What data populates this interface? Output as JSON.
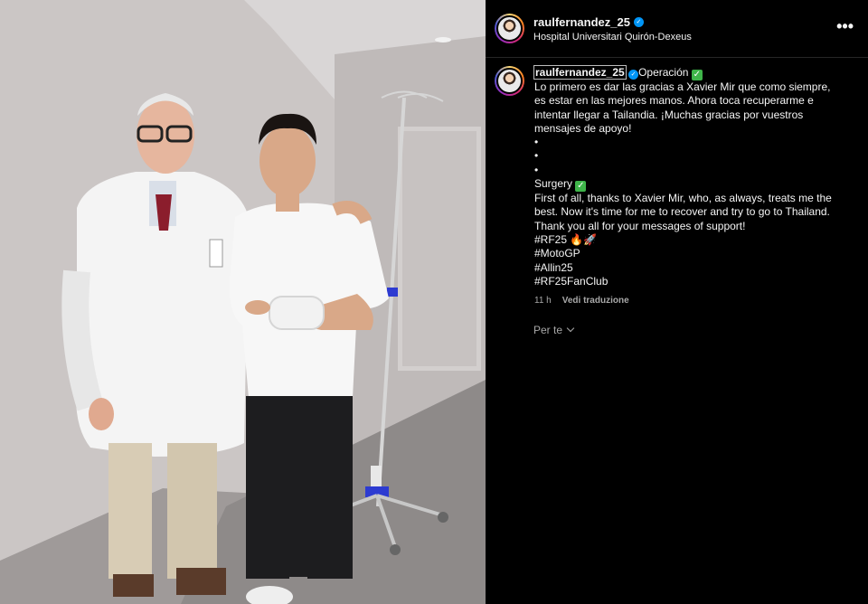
{
  "post": {
    "username": "raulfernandez_25",
    "location": "Hospital Universitari Quirón-Dexeus",
    "verified_icon": "verified-badge-icon",
    "more_icon": "more-options-icon",
    "more_glyph": "•••"
  },
  "caption": {
    "username": "raulfernandez_25",
    "title": "Operación",
    "spanish_lines": [
      "Lo primero es dar las gracias a Xavier Mir que como siempre,",
      "es estar en las mejores manos. Ahora toca recuperarme e",
      "intentar llegar a Tailandia. ¡Muchas gracias por vuestros",
      "mensajes de apoyo!"
    ],
    "dots": [
      "•",
      "•",
      "•"
    ],
    "english_title": "Surgery",
    "english_lines": [
      "First of all, thanks to Xavier Mir, who, as always, treats me the",
      "best. Now it's time for me to recover and try to go to Thailand.",
      "Thank you all for your messages of support!"
    ],
    "hashtags": [
      "#RF25 🔥🚀",
      "#MotoGP",
      "#Allin25",
      "#RF25FanClub"
    ],
    "check_glyph": "✓"
  },
  "meta": {
    "time": "11 h",
    "translate": "Vedi traduzione"
  },
  "footer": {
    "for_you": "Per te"
  },
  "colors": {
    "background": "#000000",
    "text": "#f5f5f5",
    "muted": "#a8a8a8",
    "verified": "#0095f6",
    "check": "#3fb54a"
  }
}
